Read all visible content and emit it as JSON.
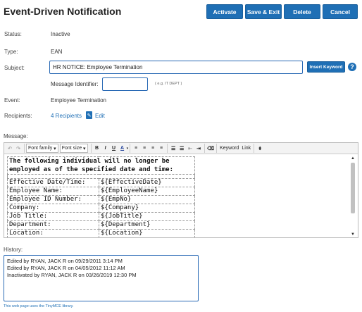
{
  "header": {
    "title": "Event-Driven Notification"
  },
  "actions": {
    "activate": "Activate",
    "save_exit": "Save & Exit",
    "delete": "Delete",
    "cancel": "Cancel"
  },
  "fields": {
    "status_label": "Status:",
    "status_value": "Inactive",
    "type_label": "Type:",
    "type_value": "EAN",
    "subject_label": "Subject:",
    "subject_value": "HR NOTICE: Employee Termination",
    "insert_keyword": "Insert Keyword",
    "msgid_label": "Message Identifier:",
    "msgid_value": "",
    "msgid_hint": "( e.g. IT DEPT )",
    "event_label": "Event:",
    "event_value": "Employee Termination",
    "recipients_label": "Recipients:",
    "recipients_value": "4 Recipients",
    "edit_label": "Edit",
    "message_label": "Message:"
  },
  "toolbar": {
    "font_family": "Font family",
    "font_size": "Font size",
    "bold": "B",
    "italic": "I",
    "underline": "U",
    "color": "A",
    "keyword": "Keyword",
    "link": "Link"
  },
  "message": {
    "heading": "The following individual will no longer be employed as of the specified date and time:",
    "rows": [
      {
        "k": "Effective Date/Time:",
        "v": "${EffectiveDate}"
      },
      {
        "k": "Employee Name:",
        "v": "${EmployeeName}"
      },
      {
        "k": "Employee ID Number:",
        "v": "${EmpNo}"
      },
      {
        "k": "Company:",
        "v": "${Company}"
      },
      {
        "k": "Job Title:",
        "v": "${JobTitle}"
      },
      {
        "k": "Department:",
        "v": "${Department}"
      },
      {
        "k": "Location:",
        "v": "${Location}"
      }
    ]
  },
  "history": {
    "label": "History:",
    "lines": [
      "Edited by RYAN, JACK R on 09/29/2011 3:14 PM",
      "Edited by RYAN, JACK R on 04/05/2012 11:12 AM",
      "Inactivated by RYAN, JACK R on 03/26/2019 12:30 PM"
    ]
  },
  "footer": {
    "text": "This web page uses the TinyMCE library."
  }
}
